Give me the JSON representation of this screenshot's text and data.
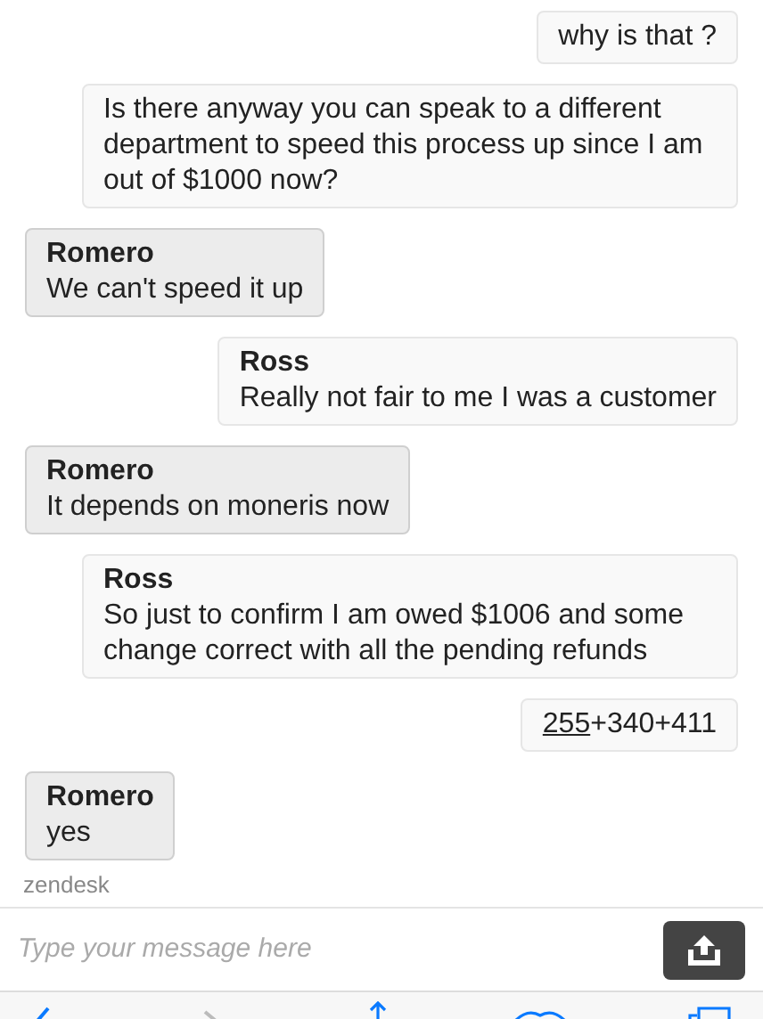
{
  "messages": [
    {
      "kind": "sent",
      "text": "why is that ?"
    },
    {
      "kind": "sent",
      "text": "Is there anyway you can speak to a different department to speed this process up since I am out of $1000 now?"
    },
    {
      "kind": "received",
      "sender": "Romero",
      "text": "We can't speed it up"
    },
    {
      "kind": "sent",
      "sender": "Ross",
      "text": "Really not fair to me I was a customer"
    },
    {
      "kind": "received",
      "sender": "Romero",
      "text": "It depends on moneris now"
    },
    {
      "kind": "sent",
      "sender": "Ross",
      "text": "So just to confirm I am owed $1006 and some change correct with all the pending refunds"
    },
    {
      "kind": "sent",
      "parts": [
        {
          "text": "255",
          "underlined": true
        },
        {
          "text": "+340+411",
          "underlined": false
        }
      ]
    },
    {
      "kind": "received",
      "sender": "Romero",
      "text": "yes"
    }
  ],
  "branding": "zendesk",
  "composer": {
    "placeholder": "Type your message here"
  }
}
